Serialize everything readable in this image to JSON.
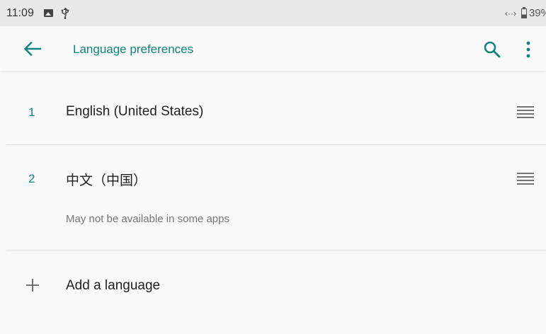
{
  "status_bar": {
    "time": "11:09",
    "battery": "39%",
    "icons": [
      "image-icon",
      "usb-icon",
      "data-transfer-icon",
      "battery-icon"
    ]
  },
  "app_bar": {
    "title": "Language preferences",
    "accent_color": "#0f8577",
    "icons": [
      "back-arrow-icon",
      "search-icon",
      "more-vert-icon"
    ]
  },
  "languages": [
    {
      "number": "1",
      "label": "English (United States)",
      "note": ""
    },
    {
      "number": "2",
      "label": "中文（中国）",
      "note": "May not be available in some apps"
    }
  ],
  "add_language": {
    "label": "Add a language",
    "icon": "plus-icon"
  },
  "colors": {
    "status_bar_bg": "#e9e9e9",
    "background": "#fafafa",
    "accent": "#0f8577",
    "divider": "#dcdcdc"
  }
}
